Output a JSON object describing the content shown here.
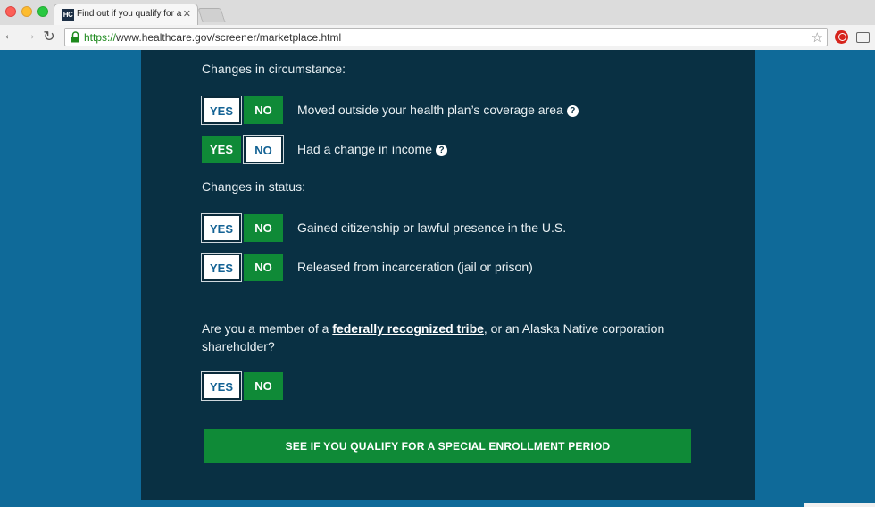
{
  "browser": {
    "tab_title": "Find out if you qualify for a",
    "tab_favicon_text": "HC",
    "tab_close": "✕",
    "url_scheme": "https://",
    "url_rest": "www.healthcare.gov/screener/marketplace.html",
    "icons": {
      "back": "arrow-left-icon",
      "forward": "arrow-right-icon",
      "reload": "reload-icon",
      "lock": "lock-icon",
      "bookmark": "star-icon",
      "extension": "extension-icon",
      "cast": "cast-icon"
    }
  },
  "page": {
    "circumstance_label": "Changes in circumstance:",
    "status_label": "Changes in status:",
    "yes_label": "YES",
    "no_label": "NO",
    "help_glyph": "?",
    "questions": {
      "moved": "Moved outside your health plan’s coverage area",
      "income": "Had a change in income",
      "citizenship": "Gained citizenship or lawful presence in the U.S.",
      "incarceration": "Released from incarceration (jail or prison)"
    },
    "selections": {
      "moved": "YES",
      "income": "NO",
      "citizenship": "YES",
      "incarceration": "YES",
      "tribe": "YES"
    },
    "tribe_question_prefix": "Are you a member of a ",
    "tribe_link": "federally recognized tribe",
    "tribe_question_suffix": ", or an Alaska Native corporation shareholder?",
    "cta_label": "SEE IF YOU QUALIFY FOR A SPECIAL ENROLLMENT PERIOD"
  },
  "colors": {
    "panel": "#093043",
    "page_bg": "#0f6a99",
    "green": "#0f8a37",
    "selected_text": "#136294"
  }
}
